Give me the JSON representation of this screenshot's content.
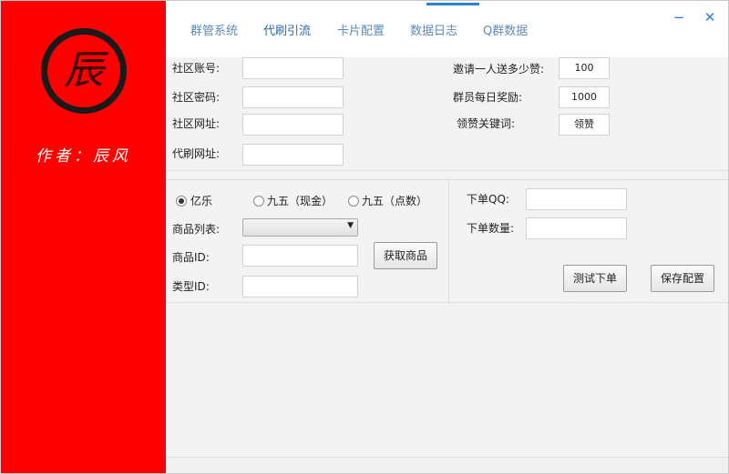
{
  "sidebar": {
    "logo_char": "辰",
    "author": "作者：辰风"
  },
  "tabs": [
    {
      "label": "群管系统",
      "active": false
    },
    {
      "label": "代刷引流",
      "active": true
    },
    {
      "label": "卡片配置",
      "active": false
    },
    {
      "label": "数据日志",
      "active": false
    },
    {
      "label": "Q群数据",
      "active": false
    }
  ],
  "window": {
    "minimize": "−",
    "close": "✕"
  },
  "community": {
    "account_label": "社区账号:",
    "account_value": "",
    "password_label": "社区密码:",
    "password_value": "",
    "url_label": "社区网址:",
    "url_value": "",
    "proxy_url_label": "代刷网址:",
    "proxy_url_value": ""
  },
  "rewards": {
    "invite_label": "邀请一人送多少赞:",
    "invite_value": "100",
    "daily_label": "群员每日奖励:",
    "daily_value": "1000",
    "keyword_label": "领赞关键词:",
    "keyword_value": "领赞"
  },
  "platform": {
    "options": [
      {
        "label": "亿乐",
        "checked": true
      },
      {
        "label": "九五（现金）",
        "checked": false
      },
      {
        "label": "九五（点数）",
        "checked": false
      }
    ],
    "product_list_label": "商品列表:",
    "product_list_value": "",
    "product_id_label": "商品ID:",
    "product_id_value": "",
    "fetch_button": "获取商品",
    "type_id_label": "类型ID:",
    "type_id_value": ""
  },
  "order": {
    "qq_label": "下单QQ:",
    "qq_value": "",
    "quantity_label": "下单数量:",
    "quantity_value": "",
    "test_button": "测试下单",
    "save_button": "保存配置"
  },
  "colors": {
    "sidebar": "#ff0000",
    "tab_text": "#5e8bb9",
    "accent": "#2d7fd4"
  }
}
